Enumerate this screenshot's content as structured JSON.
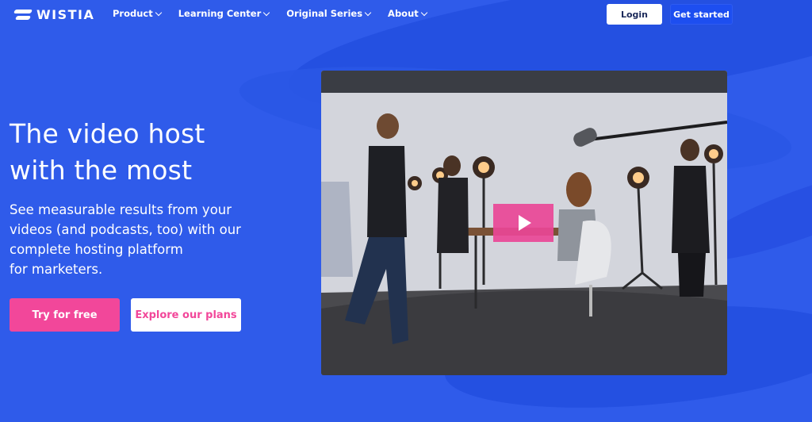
{
  "nav": {
    "logo_text": "WISTIA",
    "menu": [
      {
        "label": "Product"
      },
      {
        "label": "Learning Center"
      },
      {
        "label": "Original Series"
      },
      {
        "label": "About"
      }
    ],
    "login_label": "Login",
    "get_started_label": "Get started"
  },
  "hero": {
    "headline_line1": "The video host",
    "headline_line2": "with the most",
    "subtext_line1": "See measurable results from your",
    "subtext_line2": "videos (and podcasts, too) with our",
    "subtext_line3": "complete hosting platform",
    "subtext_line4": "for marketers.",
    "try_label": "Try for free",
    "plans_label": "Explore our plans"
  },
  "colors": {
    "background": "#2f5bea",
    "accent_pink": "#f2479a",
    "button_blue": "#1d4ef0"
  },
  "icons": {
    "logo": "wistia-logo-icon",
    "dropdown": "chevron-down-icon",
    "play": "play-icon"
  }
}
